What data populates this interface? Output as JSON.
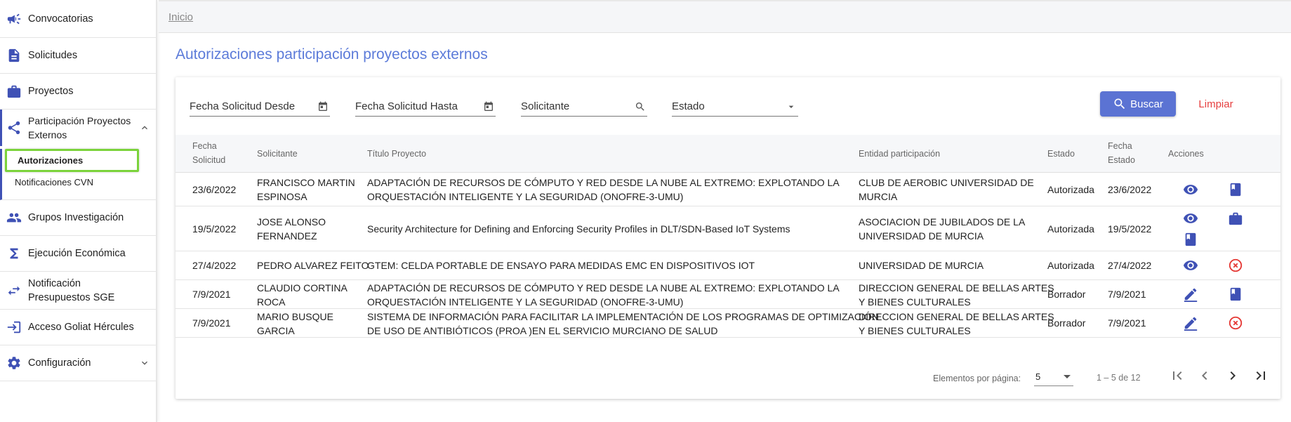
{
  "sidebar": {
    "items": [
      {
        "label": "Convocatorias",
        "icon": "megaphone-icon"
      },
      {
        "label": "Solicitudes",
        "icon": "document-icon"
      },
      {
        "label": "Proyectos",
        "icon": "briefcase-icon"
      },
      {
        "label": "Participación Proyectos Externos",
        "icon": "share-icon"
      },
      {
        "label": "Grupos Investigación",
        "icon": "group-icon"
      },
      {
        "label": "Ejecución Económica",
        "icon": "sigma-icon"
      },
      {
        "label": "Notificación Presupuestos SGE",
        "icon": "swap-arrows-icon"
      },
      {
        "label": "Acceso Goliat Hércules",
        "icon": "login-icon"
      },
      {
        "label": "Configuración",
        "icon": "gear-icon"
      }
    ],
    "submenu": {
      "autorizaciones": "Autorizaciones",
      "notificaciones": "Notificaciones CVN"
    }
  },
  "breadcrumb": "Inicio",
  "page_title": "Autorizaciones participación proyectos externos",
  "filters": {
    "fecha_desde": "Fecha Solicitud Desde",
    "fecha_hasta": "Fecha Solicitud Hasta",
    "solicitante": "Solicitante",
    "estado": "Estado",
    "buscar": "Buscar",
    "limpiar": "Limpiar"
  },
  "table": {
    "headers": {
      "fecha_solicitud_1": "Fecha",
      "fecha_solicitud_2": "Solicitud",
      "solicitante": "Solicitante",
      "titulo": "Título Proyecto",
      "entidad": "Entidad participación",
      "estado": "Estado",
      "fecha_estado_1": "Fecha",
      "fecha_estado_2": "Estado",
      "acciones": "Acciones"
    },
    "rows": [
      {
        "fecha": "23/6/2022",
        "solicitante_1": "FRANCISCO MARTIN",
        "solicitante_2": "ESPINOSA",
        "titulo_1": "ADAPTACIÓN DE RECURSOS DE CÓMPUTO Y RED DESDE LA NUBE AL EXTREMO: EXPLOTANDO LA",
        "titulo_2": "ORQUESTACIÓN INTELIGENTE Y LA SEGURIDAD (ONOFRE-3-UMU)",
        "entidad_1": "CLUB DE AEROBIC UNIVERSIDAD DE",
        "entidad_2": "MURCIA",
        "estado": "Autorizada",
        "fecha_estado": "23/6/2022"
      },
      {
        "fecha": "19/5/2022",
        "solicitante_1": "JOSE ALONSO",
        "solicitante_2": "FERNANDEZ",
        "titulo_1": "Security Architecture for Defining and Enforcing Security Profiles in DLT/SDN-Based IoT Systems",
        "titulo_2": "",
        "entidad_1": "ASOCIACION DE JUBILADOS DE LA",
        "entidad_2": "UNIVERSIDAD DE MURCIA",
        "estado": "Autorizada",
        "fecha_estado": "19/5/2022"
      },
      {
        "fecha": "27/4/2022",
        "solicitante_1": "PEDRO ALVAREZ FEITO",
        "solicitante_2": "",
        "titulo_1": "GTEM: CELDA PORTABLE DE ENSAYO PARA MEDIDAS EMC EN DISPOSITIVOS IOT",
        "titulo_2": "",
        "entidad_1": "UNIVERSIDAD DE MURCIA",
        "entidad_2": "",
        "estado": "Autorizada",
        "fecha_estado": "27/4/2022"
      },
      {
        "fecha": "7/9/2021",
        "solicitante_1": "CLAUDIO CORTINA",
        "solicitante_2": "ROCA",
        "titulo_1": "ADAPTACIÓN DE RECURSOS DE CÓMPUTO Y RED DESDE LA NUBE AL EXTREMO: EXPLOTANDO LA",
        "titulo_2": "ORQUESTACIÓN INTELIGENTE Y LA SEGURIDAD (ONOFRE-3-UMU)",
        "entidad_1": "DIRECCION GENERAL DE BELLAS ARTES",
        "entidad_2": "Y BIENES CULTURALES",
        "estado": "Borrador",
        "fecha_estado": "7/9/2021"
      },
      {
        "fecha": "7/9/2021",
        "solicitante_1": "MARIO BUSQUE",
        "solicitante_2": "GARCIA",
        "titulo_1": "SISTEMA DE INFORMACIÓN PARA FACILITAR LA IMPLEMENTACIÓN DE LOS PROGRAMAS DE OPTIMIZACIÓN",
        "titulo_2": "DE USO DE ANTIBIÓTICOS (PROA )EN EL SERVICIO MURCIANO DE SALUD",
        "entidad_1": "DIRECCION GENERAL DE BELLAS ARTES",
        "entidad_2": "Y BIENES CULTURALES",
        "estado": "Borrador",
        "fecha_estado": "7/9/2021"
      }
    ]
  },
  "pagination": {
    "label": "Elementos por página:",
    "page_size": "5",
    "range": "1 – 5 de 12"
  },
  "colors": {
    "primary": "#5b73d3",
    "icon_blue": "#3f51b5",
    "danger": "#e53935",
    "highlight": "#7bd33b"
  }
}
